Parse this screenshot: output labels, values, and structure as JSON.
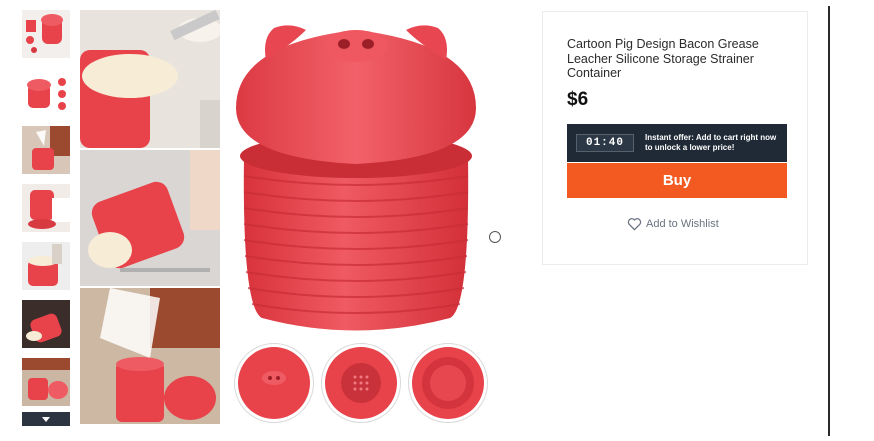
{
  "product": {
    "title": "Cartoon Pig Design Bacon Grease Leacher Silicone Storage Strainer Container",
    "price": "$6"
  },
  "offer": {
    "timer": "01:40",
    "text": "Instant offer: Add to cart right now to unlock a lower price!"
  },
  "buttons": {
    "buy_label": "Buy",
    "wishlist_label": "Add to Wishlist"
  },
  "icons": {
    "wishlist": "heart-icon",
    "scroll_down": "chevron-down-icon"
  },
  "colors": {
    "accent": "#f25a22",
    "offer_bar": "#1f2a36",
    "product_red": "#e8424a"
  }
}
